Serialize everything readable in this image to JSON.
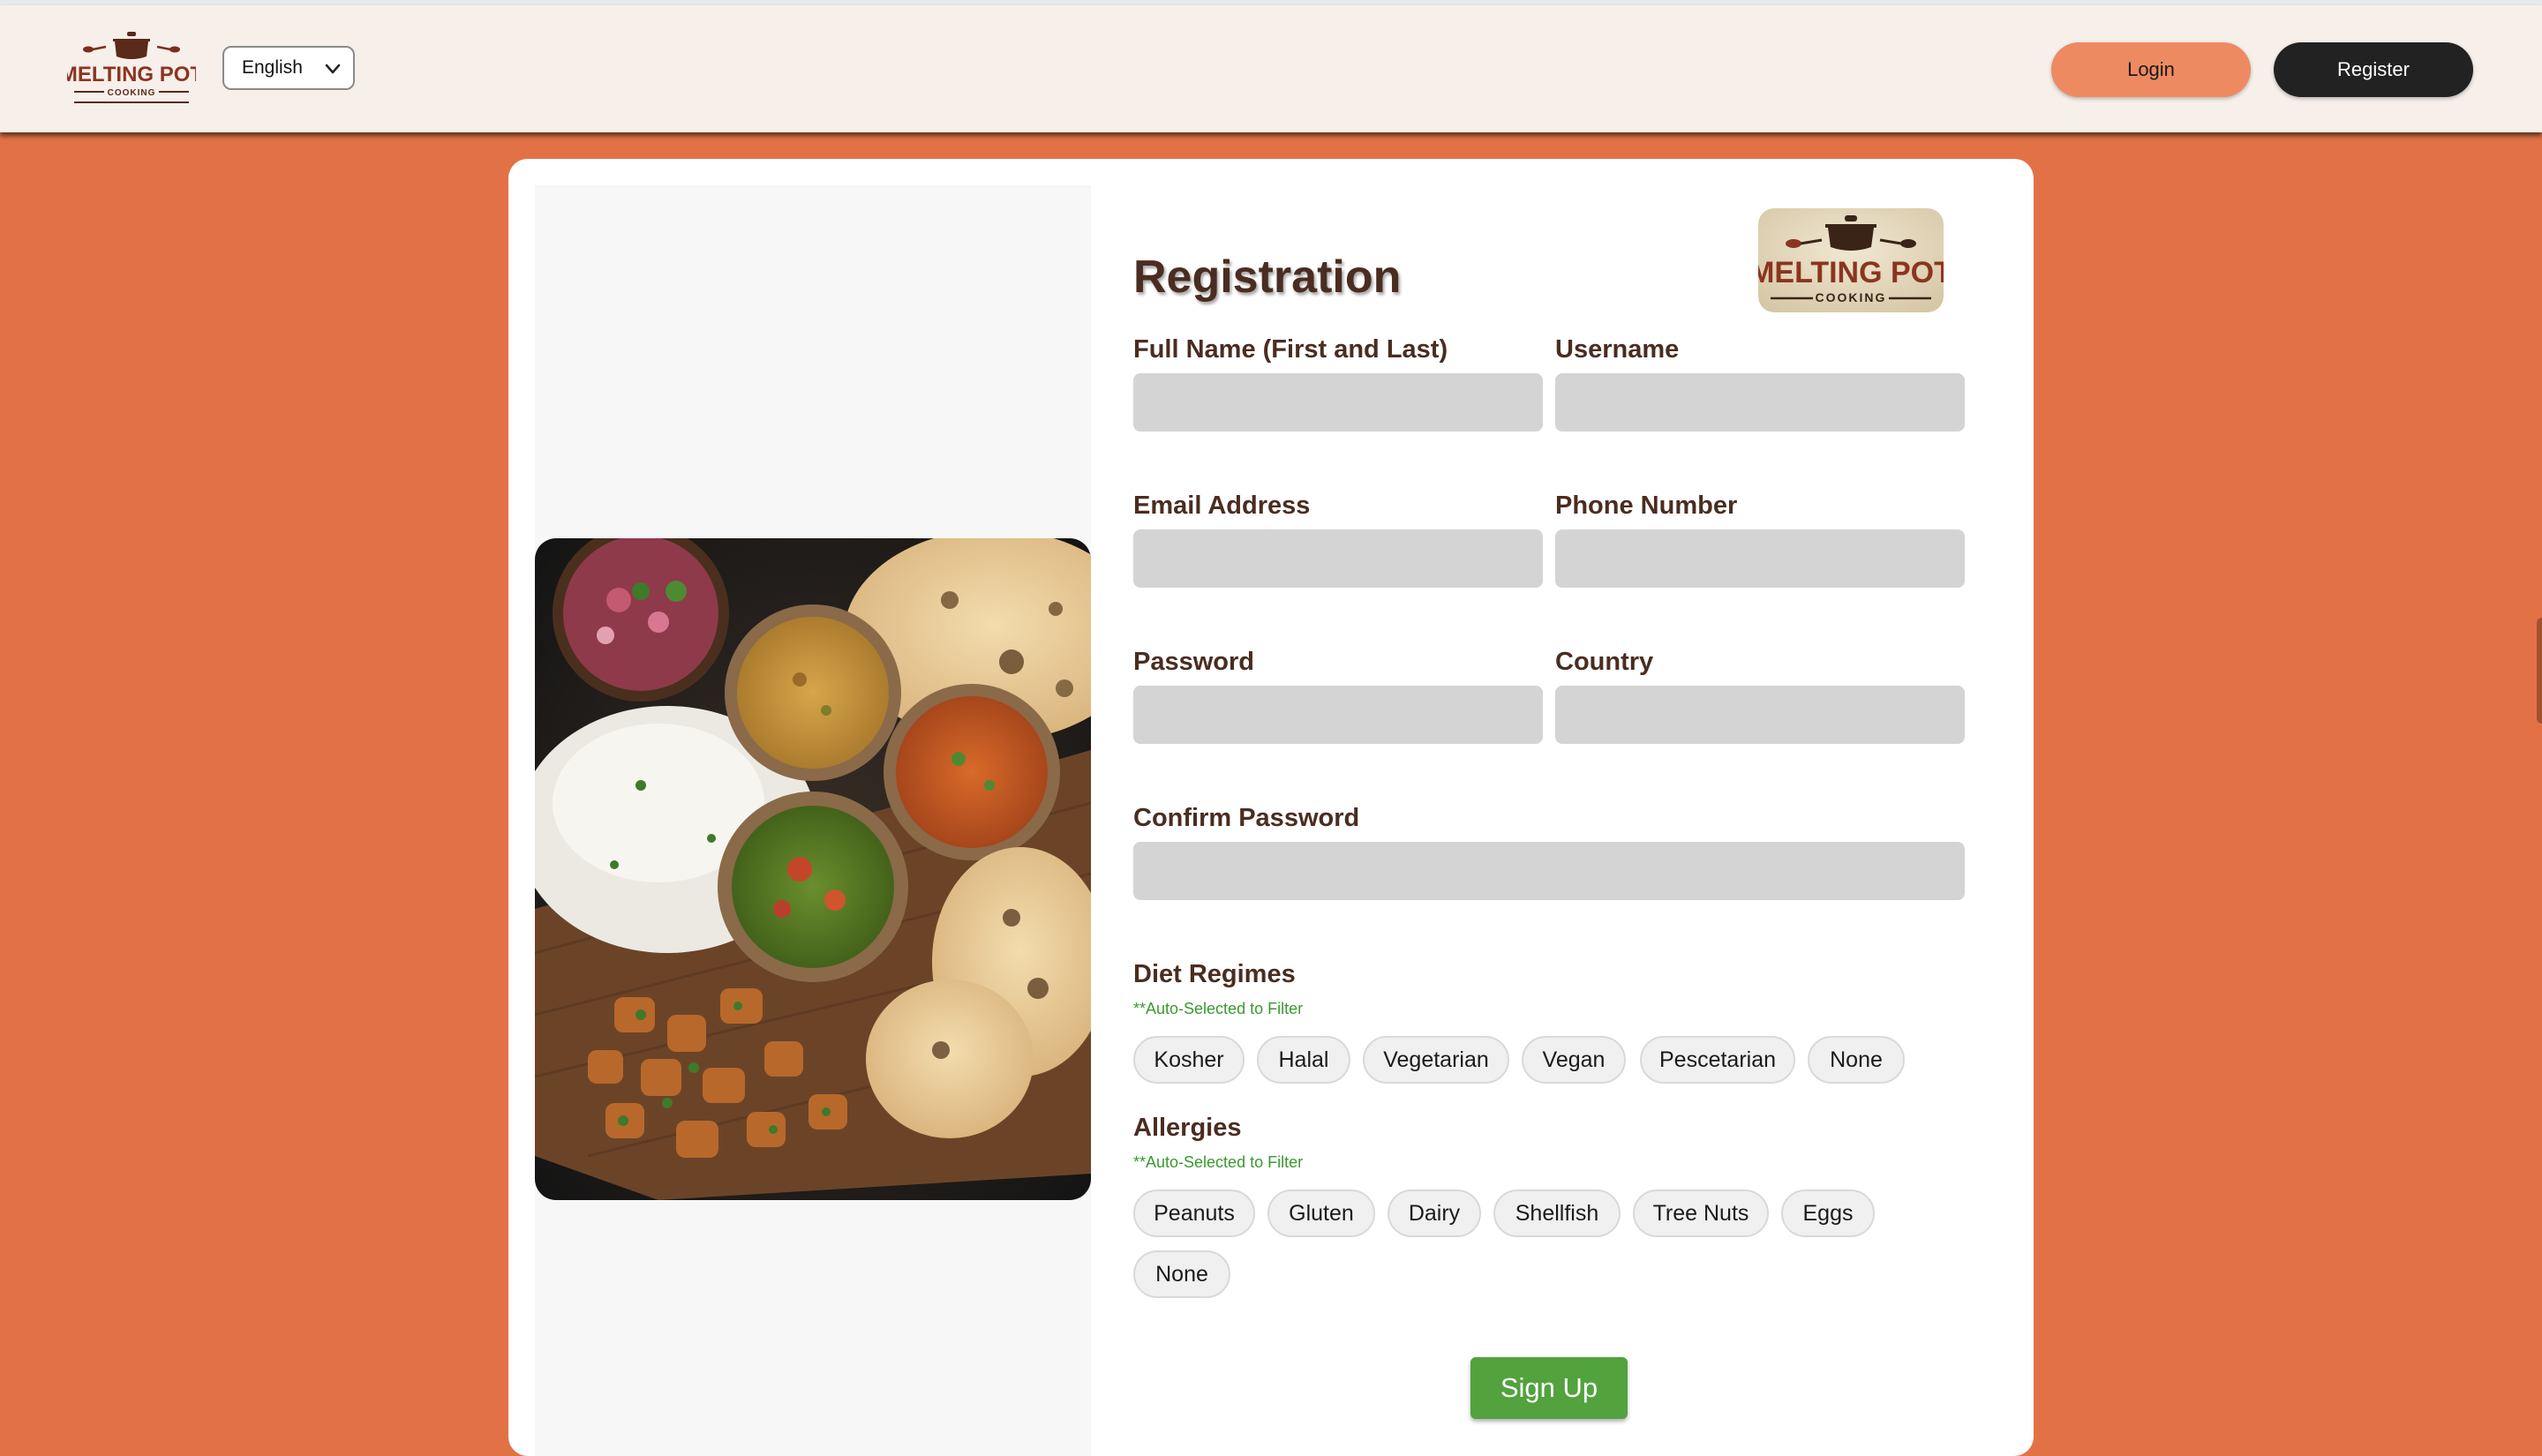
{
  "header": {
    "logo": {
      "text_top": "MELTING POT",
      "text_bottom": "COOKING"
    },
    "language": {
      "selected": "English",
      "icon": "chevron-down-icon"
    },
    "login_label": "Login",
    "register_label": "Register"
  },
  "form": {
    "title": "Registration",
    "logo": {
      "text_top": "MELTING POT",
      "text_bottom": "COOKING"
    },
    "fields": {
      "full_name": {
        "label": "Full Name (First and Last)",
        "value": ""
      },
      "username": {
        "label": "Username",
        "value": ""
      },
      "email": {
        "label": "Email Address",
        "value": ""
      },
      "phone": {
        "label": "Phone Number",
        "value": ""
      },
      "password": {
        "label": "Password",
        "value": ""
      },
      "country": {
        "label": "Country",
        "value": ""
      },
      "confirm_password": {
        "label": "Confirm Password",
        "value": ""
      }
    },
    "diet": {
      "title": "Diet Regimes",
      "note": "**Auto-Selected to Filter",
      "options": [
        "Kosher",
        "Halal",
        "Vegetarian",
        "Vegan",
        "Pescetarian",
        "None"
      ]
    },
    "allergies": {
      "title": "Allergies",
      "note": "**Auto-Selected to Filter",
      "options": [
        "Peanuts",
        "Gluten",
        "Dairy",
        "Shellfish",
        "Tree Nuts",
        "Eggs",
        "None"
      ]
    },
    "submit_label": "Sign Up"
  },
  "colors": {
    "page_background": "#e27246",
    "header_background": "#f6efea",
    "login_button": "#ee8a62",
    "register_button": "#222222",
    "label_brown": "#4a2d20",
    "input_gray": "#d4d4d4",
    "note_green": "#3a9a2f",
    "signup_green": "#52a23d"
  }
}
